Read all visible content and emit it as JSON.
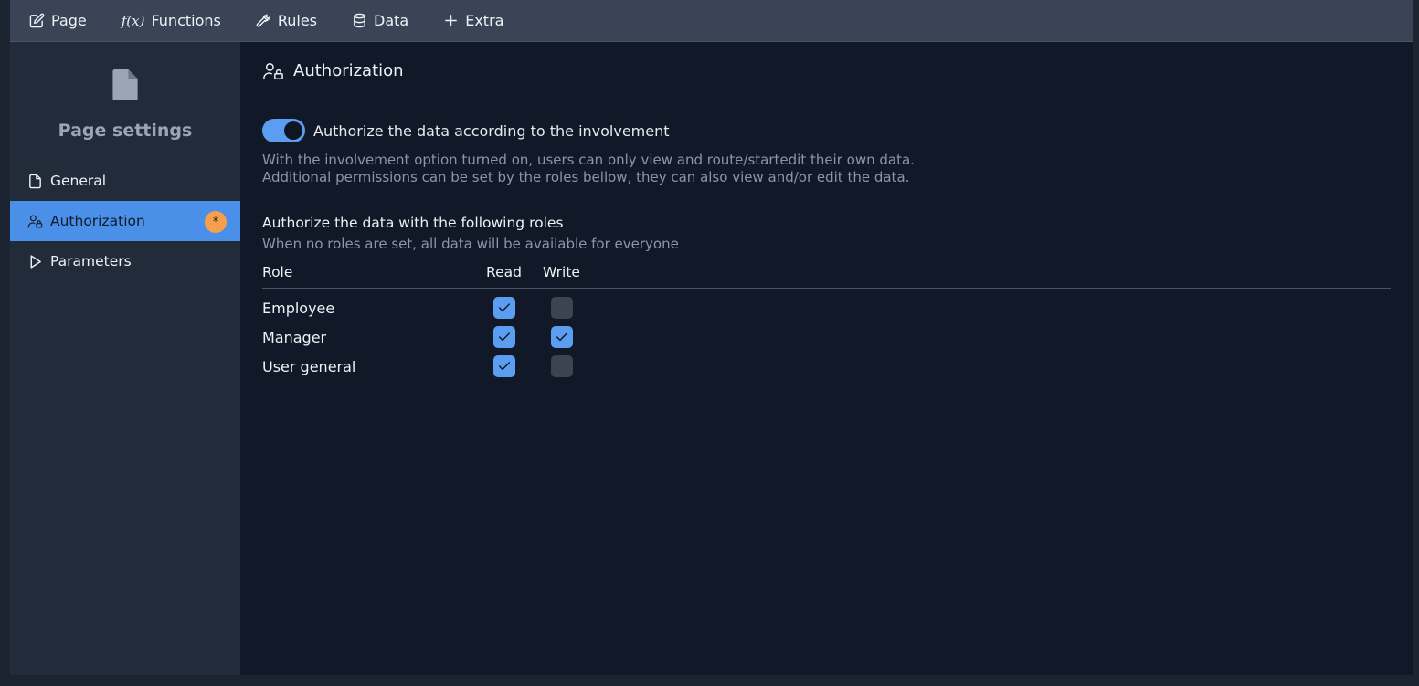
{
  "menubar": {
    "items": [
      {
        "label": "Page",
        "icon": "edit-icon"
      },
      {
        "label": "Functions",
        "icon": "function-icon"
      },
      {
        "label": "Rules",
        "icon": "gavel-icon"
      },
      {
        "label": "Data",
        "icon": "database-icon"
      },
      {
        "label": "Extra",
        "icon": "plus-icon"
      }
    ]
  },
  "sidebar": {
    "title": "Page settings",
    "items": [
      {
        "label": "General",
        "icon": "document-icon"
      },
      {
        "label": "Authorization",
        "icon": "user-lock-icon",
        "badge": "*",
        "active": true
      },
      {
        "label": "Parameters",
        "icon": "play-icon"
      }
    ]
  },
  "main": {
    "section_title": "Authorization",
    "toggle_label": "Authorize the data according to the involvement",
    "toggle_on": true,
    "help_line1": "With the involvement option turned on, users can only view and route/startedit their own data.",
    "help_line2": "Additional permissions can be set by the roles bellow, they can also view and/or edit the data.",
    "roles_title": "Authorize the data with the following roles",
    "roles_subtitle": "When no roles are set, all data will be available for everyone",
    "columns": {
      "role": "Role",
      "read": "Read",
      "write": "Write"
    },
    "roles": [
      {
        "name": "Employee",
        "read": true,
        "write": false
      },
      {
        "name": "Manager",
        "read": true,
        "write": true
      },
      {
        "name": "User general",
        "read": true,
        "write": false
      }
    ]
  },
  "colors": {
    "accent": "#5b9df0",
    "active_nav": "#4a8fe8",
    "badge": "#f6a04d",
    "background": "#111827",
    "sidebar": "#212b3a",
    "menubar": "#3a4457"
  }
}
